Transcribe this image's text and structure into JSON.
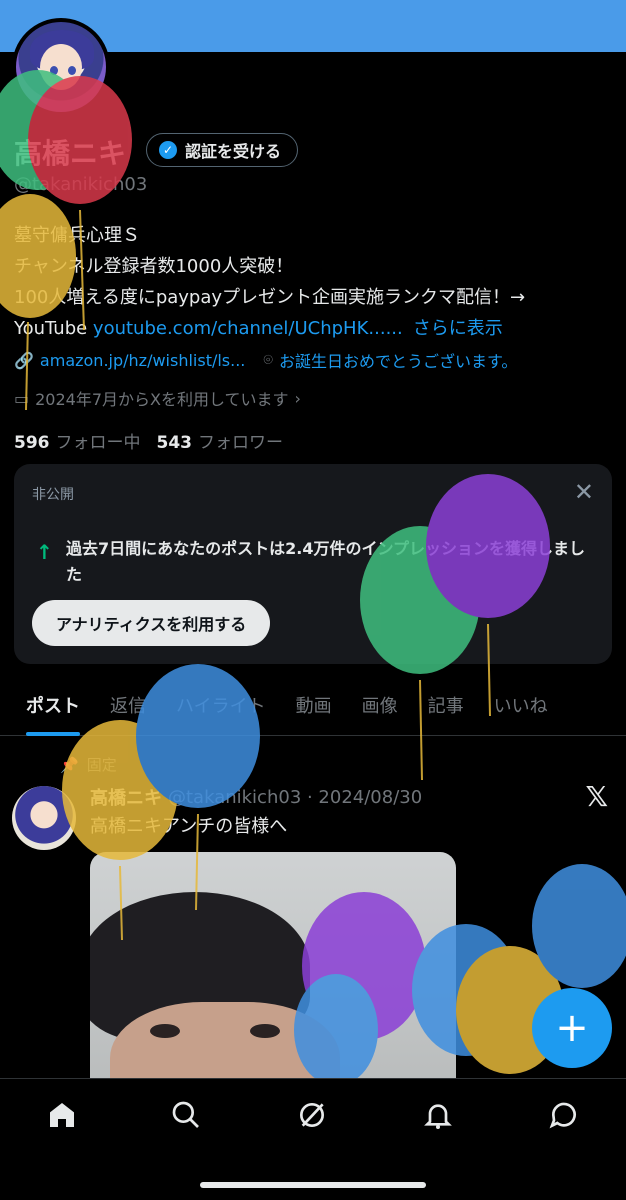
{
  "profile": {
    "name": "高橋ニキ",
    "handle": "@takanikich03",
    "verify_label": "認証を受ける",
    "bio_lines": [
      "墓守傭兵心理Ｓ",
      "チャンネル登録者数1000人突破！",
      "100人増える度にpaypayプレゼント企画実施ランクマ配信！→"
    ],
    "bio_youtube_prefix": "YouTube ",
    "bio_link": "youtube.com/channel/UChpHK......",
    "show_more": "さらに表示",
    "website": "amazon.jp/hz/wishlist/ls...",
    "location": "お誕生日おめでとうございます。",
    "joined": "2024年7月からXを利用しています",
    "following_count": "596",
    "following_label": "フォロー中",
    "followers_count": "543",
    "followers_label": "フォロワー"
  },
  "insight_card": {
    "private_label": "非公開",
    "message": "過去7日間にあなたのポストは2.4万件のインプレッションを獲得しました",
    "button": "アナリティクスを利用する"
  },
  "tabs": [
    "ポスト",
    "返信",
    "ハイライト",
    "動画",
    "画像",
    "記事",
    "いいね"
  ],
  "pinned_post": {
    "pinned_label": "固定",
    "name": "高橋ニキ",
    "meta": "@takanikich03 · 2024/08/30",
    "text": "高橋ニキアンチの皆様へ"
  },
  "colors": {
    "accent": "#1d9bf0",
    "banner": "#4a9be9",
    "balloon_red": "#d9394b",
    "balloon_green": "#3fbf7f",
    "balloon_yellow": "#e6b93a",
    "balloon_blue": "#3f8fe0",
    "balloon_purple": "#8b3fd6"
  },
  "icons": [
    "verified-badge-icon",
    "link-icon",
    "location-icon",
    "calendar-icon",
    "close-icon",
    "arrow-up-icon",
    "pin-icon",
    "x-logo-icon",
    "plus-icon",
    "home-icon",
    "search-icon",
    "grok-icon",
    "bell-icon",
    "message-icon"
  ]
}
